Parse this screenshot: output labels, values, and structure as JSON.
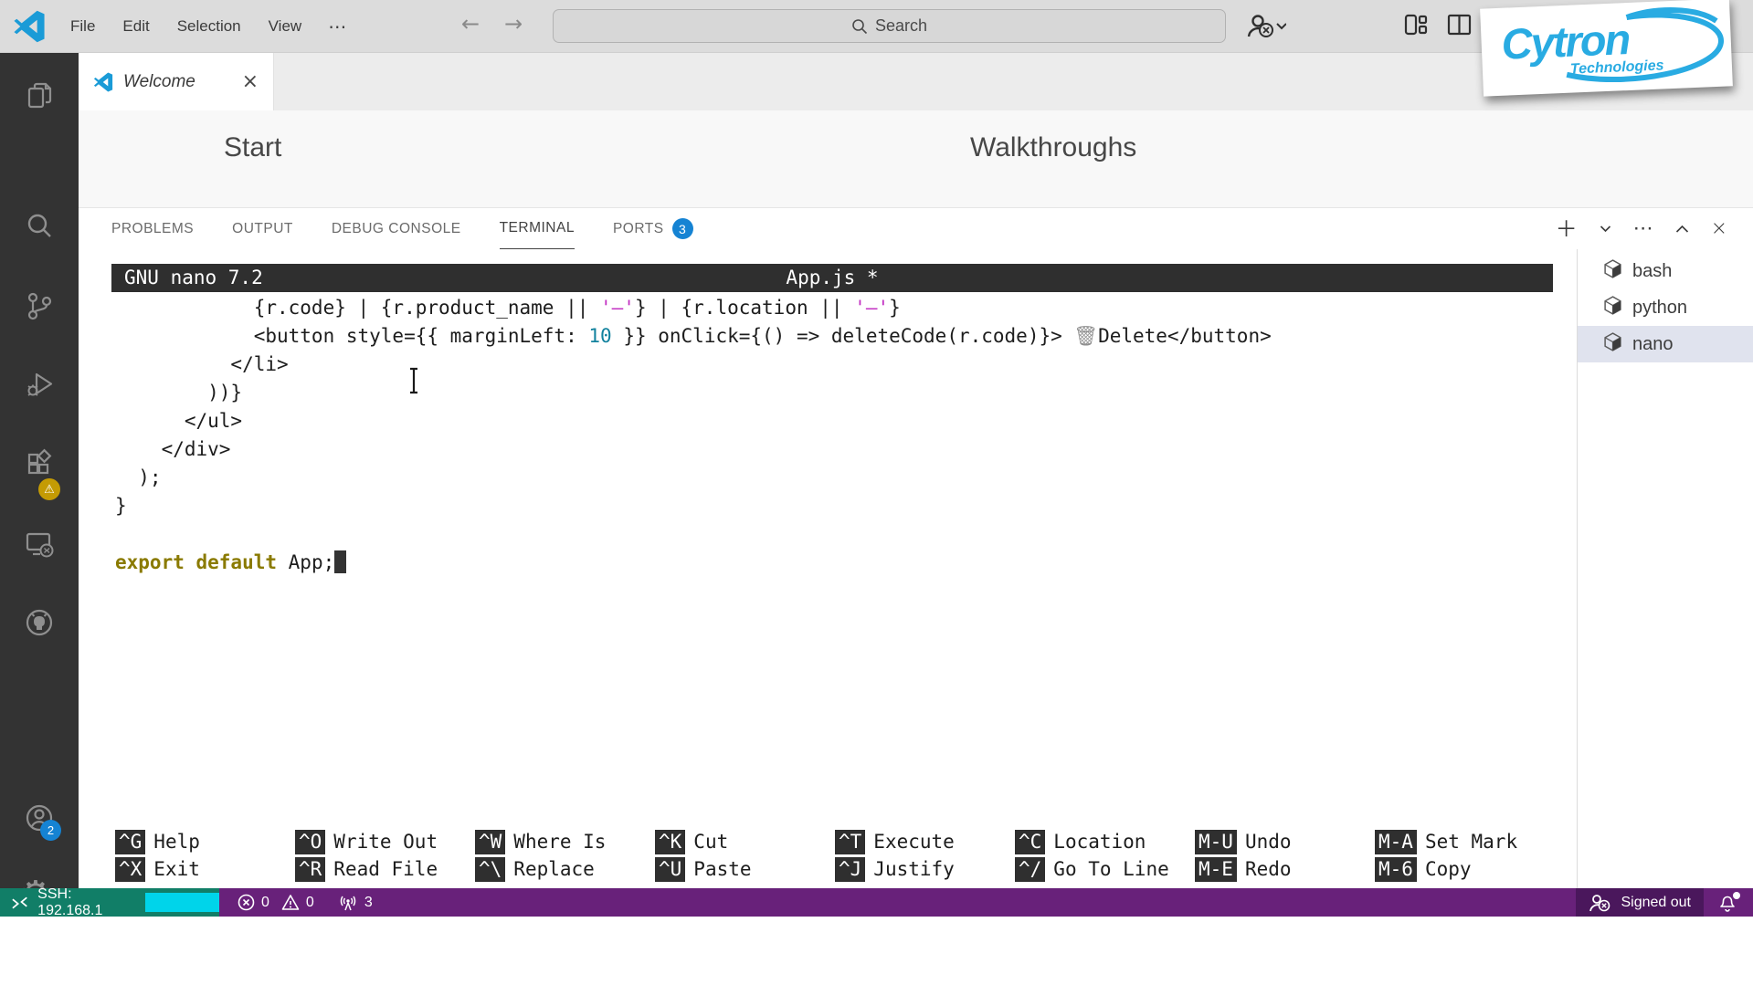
{
  "titlebar": {
    "menus": [
      "File",
      "Edit",
      "Selection",
      "View"
    ],
    "search_placeholder": "Search"
  },
  "logo": {
    "brand": "Cytron",
    "sub": "Technologies"
  },
  "tabs": {
    "welcome": "Welcome"
  },
  "welcome": {
    "start_heading": "Start",
    "walkthroughs_heading": "Walkthroughs"
  },
  "panel": {
    "tabs": [
      "PROBLEMS",
      "OUTPUT",
      "DEBUG CONSOLE",
      "TERMINAL",
      "PORTS"
    ],
    "ports_badge": "3"
  },
  "nano": {
    "app_title": "GNU nano 7.2",
    "file_title": "App.js *",
    "code": [
      [
        {
          "t": "            {r.code} | {r.product_name || "
        },
        {
          "t": "'–'",
          "c": "str"
        },
        {
          "t": "} | {r.location || "
        },
        {
          "t": "'–'",
          "c": "str"
        },
        {
          "t": "}"
        }
      ],
      [
        {
          "t": "            <button style={{ marginLeft: "
        },
        {
          "t": "10",
          "c": "num"
        },
        {
          "t": " }} onClick={() => deleteCode(r.code)}> "
        },
        {
          "t": "🗑",
          "c": "trash"
        },
        {
          "t": "Delete</button>"
        }
      ],
      [
        {
          "t": "          </li>"
        }
      ],
      [
        {
          "t": "        ))}"
        }
      ],
      [
        {
          "t": "      </ul>"
        }
      ],
      [
        {
          "t": "    </div>"
        }
      ],
      [
        {
          "t": "  );"
        }
      ],
      [
        {
          "t": "}"
        }
      ],
      [
        {
          "t": ""
        }
      ],
      [
        {
          "t": "export default",
          "c": "kw"
        },
        {
          "t": " App;"
        },
        {
          "t": "",
          "c": "cursor"
        }
      ]
    ],
    "shortcuts": [
      {
        "key": "^G",
        "label": "Help"
      },
      {
        "key": "^X",
        "label": "Exit"
      },
      {
        "key": "^O",
        "label": "Write Out"
      },
      {
        "key": "^R",
        "label": "Read File"
      },
      {
        "key": "^W",
        "label": "Where Is"
      },
      {
        "key": "^\\",
        "label": "Replace"
      },
      {
        "key": "^K",
        "label": "Cut"
      },
      {
        "key": "^U",
        "label": "Paste"
      },
      {
        "key": "^T",
        "label": "Execute"
      },
      {
        "key": "^J",
        "label": "Justify"
      },
      {
        "key": "^C",
        "label": "Location"
      },
      {
        "key": "^/",
        "label": "Go To Line"
      },
      {
        "key": "M-U",
        "label": "Undo"
      },
      {
        "key": "M-E",
        "label": "Redo"
      },
      {
        "key": "M-A",
        "label": "Set Mark"
      },
      {
        "key": "M-6",
        "label": "Copy"
      }
    ]
  },
  "terminals": [
    {
      "name": "bash",
      "active": false
    },
    {
      "name": "python",
      "active": false
    },
    {
      "name": "nano",
      "active": true
    }
  ],
  "statusbar": {
    "remote": "SSH: 192.168.1",
    "errors": "0",
    "warnings": "0",
    "ports": "3",
    "account": "Signed out"
  },
  "badges": {
    "accounts": "2"
  },
  "colors": {
    "accent_blue": "#1583d3",
    "remote_teal": "#117e67",
    "status_purple": "#68217a",
    "logo_blue": "#29abe2",
    "redaction_cyan": "#00d4ea",
    "warning_gold": "#c49b04"
  }
}
